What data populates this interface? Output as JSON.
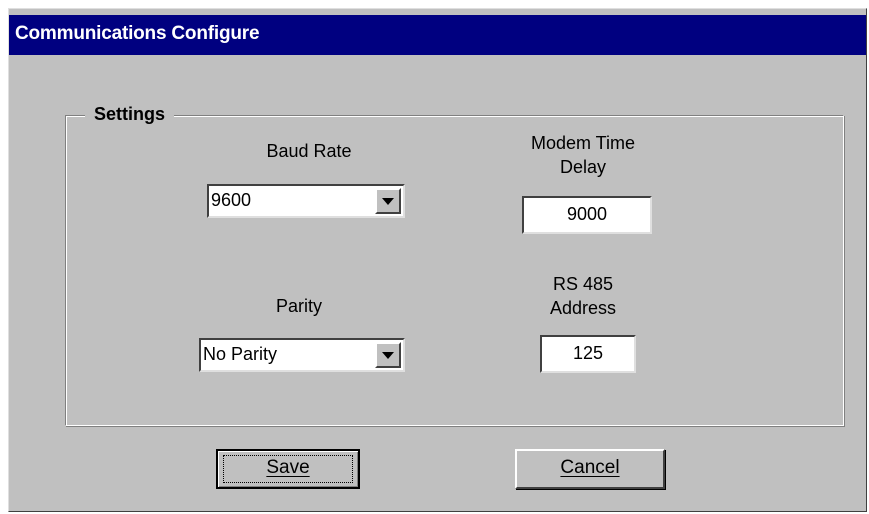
{
  "window": {
    "title": "Communications Configure"
  },
  "settings": {
    "group_label": "Settings",
    "baud_rate": {
      "label": "Baud Rate",
      "value": "9600"
    },
    "parity": {
      "label": "Parity",
      "value": "No Parity"
    },
    "modem_time_delay": {
      "label_line1": "Modem Time",
      "label_line2": "Delay",
      "value": "9000"
    },
    "rs485_address": {
      "label_line1": "RS 485",
      "label_line2": "Address",
      "value": "125"
    }
  },
  "buttons": {
    "save_label": "Save",
    "cancel_label": "Cancel"
  },
  "colors": {
    "titlebar": "#000080",
    "face": "#c0c0c0"
  }
}
